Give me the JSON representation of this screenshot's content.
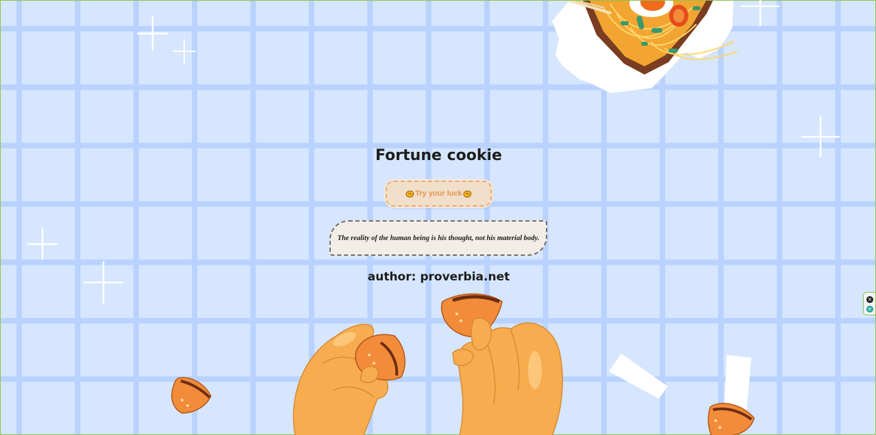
{
  "page": {
    "title": "Fortune cookie",
    "button_label": "Try your luck",
    "quote": "The reality of the human being is his thought, not his material body.",
    "author": "author: proverbia.net"
  },
  "colors": {
    "background": "#d6e6ff",
    "grid_lines": "#b9d2ff",
    "button_bg": "#f1dfc9",
    "button_text": "#e3954f",
    "quote_bg": "#f2ede6",
    "cookie": "#f28c3a",
    "hand": "#f7ad4f"
  },
  "side_widget": {
    "close_icon": "×",
    "extension_icon": "e"
  }
}
